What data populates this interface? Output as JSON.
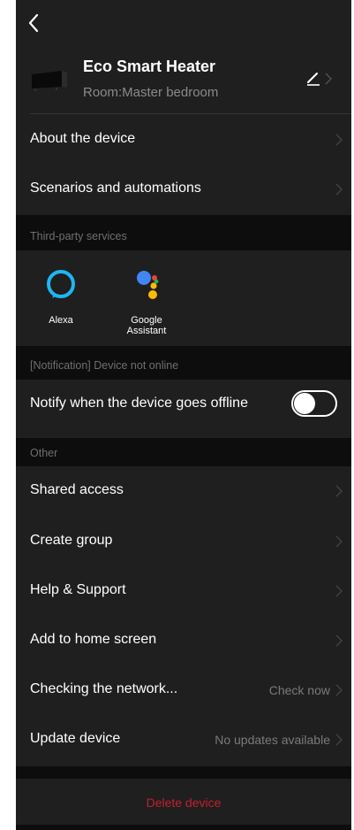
{
  "header": {
    "back_icon": "chevron-left-icon"
  },
  "device": {
    "name": "Eco Smart Heater",
    "room": "Room:Master bedroom",
    "edit_icon": "pencil-icon",
    "thumbnail_icon": "heater-thumbnail-icon"
  },
  "menu_top": [
    {
      "label": "About the device"
    },
    {
      "label": "Scenarios and automations"
    }
  ],
  "third_party": {
    "section_label": "Third-party services",
    "services": [
      {
        "label": "Alexa",
        "icon": "alexa-icon"
      },
      {
        "label": "Google\nAssistant",
        "icon": "google-assistant-icon"
      }
    ]
  },
  "notification": {
    "section_label": "[Notification] Device not online",
    "row_label": "Notify when the device goes offline",
    "toggle_on": false
  },
  "other": {
    "section_label": "Other",
    "items": [
      {
        "label": "Shared access",
        "value": ""
      },
      {
        "label": "Create group",
        "value": ""
      },
      {
        "label": "Help & Support",
        "value": ""
      },
      {
        "label": "Add to home screen",
        "value": ""
      },
      {
        "label": "Checking the network...",
        "value": "Check now"
      },
      {
        "label": "Update device",
        "value": "No updates available"
      }
    ]
  },
  "delete_label": "Delete device",
  "colors": {
    "background": "#1f1f1f",
    "section": "#0d0d0d",
    "danger": "#c0202d",
    "muted": "#7a7a7a"
  }
}
